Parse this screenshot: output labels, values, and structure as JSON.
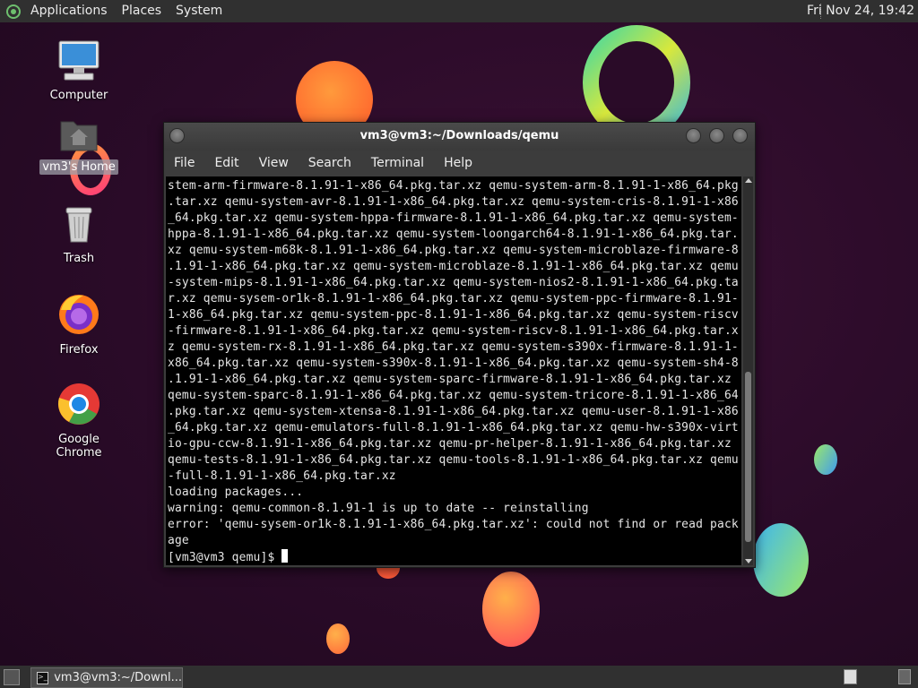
{
  "top_panel": {
    "menus": [
      "Applications",
      "Places",
      "System"
    ],
    "clock": "Fri Nov 24, 19:42"
  },
  "desktop_icons": [
    {
      "label": "Computer",
      "icon": "computer-icon"
    },
    {
      "label": "vm3's Home",
      "icon": "home-folder-icon",
      "selected": true
    },
    {
      "label": "Trash",
      "icon": "trash-icon"
    },
    {
      "label": "Firefox",
      "icon": "firefox-icon"
    },
    {
      "label": "Google Chrome",
      "icon": "chrome-icon"
    }
  ],
  "terminal": {
    "title": "vm3@vm3:~/Downloads/qemu",
    "menu": [
      "File",
      "Edit",
      "View",
      "Search",
      "Terminal",
      "Help"
    ],
    "lines": [
      "stem-arm-firmware-8.1.91-1-x86_64.pkg.tar.xz qemu-system-arm-8.1.91-1-x86_64.pkg",
      ".tar.xz qemu-system-avr-8.1.91-1-x86_64.pkg.tar.xz qemu-system-cris-8.1.91-1-x86",
      "_64.pkg.tar.xz qemu-system-hppa-firmware-8.1.91-1-x86_64.pkg.tar.xz qemu-system-",
      "hppa-8.1.91-1-x86_64.pkg.tar.xz qemu-system-loongarch64-8.1.91-1-x86_64.pkg.tar.",
      "xz qemu-system-m68k-8.1.91-1-x86_64.pkg.tar.xz qemu-system-microblaze-firmware-8",
      ".1.91-1-x86_64.pkg.tar.xz qemu-system-microblaze-8.1.91-1-x86_64.pkg.tar.xz qemu",
      "-system-mips-8.1.91-1-x86_64.pkg.tar.xz qemu-system-nios2-8.1.91-1-x86_64.pkg.ta",
      "r.xz qemu-sysem-or1k-8.1.91-1-x86_64.pkg.tar.xz qemu-system-ppc-firmware-8.1.91-",
      "1-x86_64.pkg.tar.xz qemu-system-ppc-8.1.91-1-x86_64.pkg.tar.xz qemu-system-riscv",
      "-firmware-8.1.91-1-x86_64.pkg.tar.xz qemu-system-riscv-8.1.91-1-x86_64.pkg.tar.x",
      "z qemu-system-rx-8.1.91-1-x86_64.pkg.tar.xz qemu-system-s390x-firmware-8.1.91-1-",
      "x86_64.pkg.tar.xz qemu-system-s390x-8.1.91-1-x86_64.pkg.tar.xz qemu-system-sh4-8",
      ".1.91-1-x86_64.pkg.tar.xz qemu-system-sparc-firmware-8.1.91-1-x86_64.pkg.tar.xz",
      "qemu-system-sparc-8.1.91-1-x86_64.pkg.tar.xz qemu-system-tricore-8.1.91-1-x86_64",
      ".pkg.tar.xz qemu-system-xtensa-8.1.91-1-x86_64.pkg.tar.xz qemu-user-8.1.91-1-x86",
      "_64.pkg.tar.xz qemu-emulators-full-8.1.91-1-x86_64.pkg.tar.xz qemu-hw-s390x-virt",
      "io-gpu-ccw-8.1.91-1-x86_64.pkg.tar.xz qemu-pr-helper-8.1.91-1-x86_64.pkg.tar.xz",
      "qemu-tests-8.1.91-1-x86_64.pkg.tar.xz qemu-tools-8.1.91-1-x86_64.pkg.tar.xz qemu",
      "-full-8.1.91-1-x86_64.pkg.tar.xz",
      "loading packages...",
      "warning: qemu-common-8.1.91-1 is up to date -- reinstalling",
      "error: 'qemu-sysem-or1k-8.1.91-1-x86_64.pkg.tar.xz': could not find or read pack",
      "age"
    ],
    "prompt": "[vm3@vm3 qemu]$ "
  },
  "bottom_panel": {
    "task_label": "vm3@vm3:~/Downl..."
  },
  "colors": {
    "panel": "#303030",
    "terminal_bg": "#000000",
    "terminal_fg": "#e6e6e6"
  }
}
